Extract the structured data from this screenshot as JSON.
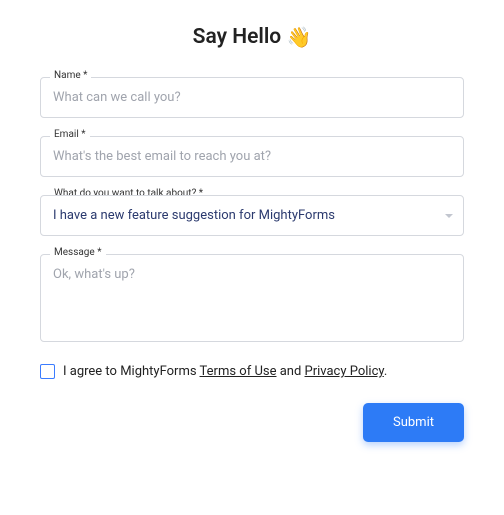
{
  "title": "Say Hello",
  "emoji": "👋",
  "fields": {
    "name": {
      "label": "Name *",
      "placeholder": "What can we call you?",
      "value": ""
    },
    "email": {
      "label": "Email *",
      "placeholder": "What's the best email to reach you at?",
      "value": ""
    },
    "topic": {
      "label": "What do you want to talk about? *",
      "selected": "I have a new feature suggestion for MightyForms"
    },
    "message": {
      "label": "Message *",
      "placeholder": "Ok, what's up?",
      "value": ""
    }
  },
  "consent": {
    "prefix": "I agree to MightyForms ",
    "terms": "Terms of Use",
    "and": " and ",
    "privacy": "Privacy Policy",
    "suffix": "."
  },
  "submit_label": "Submit"
}
